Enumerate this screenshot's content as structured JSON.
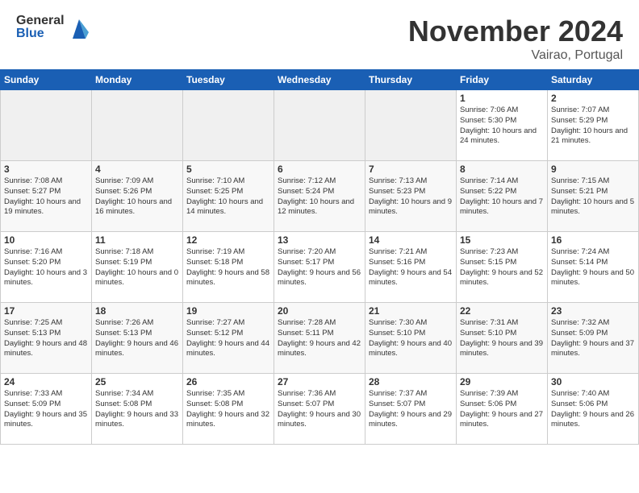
{
  "header": {
    "logo_general": "General",
    "logo_blue": "Blue",
    "month_title": "November 2024",
    "location": "Vairao, Portugal"
  },
  "days_of_week": [
    "Sunday",
    "Monday",
    "Tuesday",
    "Wednesday",
    "Thursday",
    "Friday",
    "Saturday"
  ],
  "weeks": [
    [
      {
        "day": "",
        "info": ""
      },
      {
        "day": "",
        "info": ""
      },
      {
        "day": "",
        "info": ""
      },
      {
        "day": "",
        "info": ""
      },
      {
        "day": "",
        "info": ""
      },
      {
        "day": "1",
        "info": "Sunrise: 7:06 AM\nSunset: 5:30 PM\nDaylight: 10 hours\nand 24 minutes."
      },
      {
        "day": "2",
        "info": "Sunrise: 7:07 AM\nSunset: 5:29 PM\nDaylight: 10 hours\nand 21 minutes."
      }
    ],
    [
      {
        "day": "3",
        "info": "Sunrise: 7:08 AM\nSunset: 5:27 PM\nDaylight: 10 hours\nand 19 minutes."
      },
      {
        "day": "4",
        "info": "Sunrise: 7:09 AM\nSunset: 5:26 PM\nDaylight: 10 hours\nand 16 minutes."
      },
      {
        "day": "5",
        "info": "Sunrise: 7:10 AM\nSunset: 5:25 PM\nDaylight: 10 hours\nand 14 minutes."
      },
      {
        "day": "6",
        "info": "Sunrise: 7:12 AM\nSunset: 5:24 PM\nDaylight: 10 hours\nand 12 minutes."
      },
      {
        "day": "7",
        "info": "Sunrise: 7:13 AM\nSunset: 5:23 PM\nDaylight: 10 hours\nand 9 minutes."
      },
      {
        "day": "8",
        "info": "Sunrise: 7:14 AM\nSunset: 5:22 PM\nDaylight: 10 hours\nand 7 minutes."
      },
      {
        "day": "9",
        "info": "Sunrise: 7:15 AM\nSunset: 5:21 PM\nDaylight: 10 hours\nand 5 minutes."
      }
    ],
    [
      {
        "day": "10",
        "info": "Sunrise: 7:16 AM\nSunset: 5:20 PM\nDaylight: 10 hours\nand 3 minutes."
      },
      {
        "day": "11",
        "info": "Sunrise: 7:18 AM\nSunset: 5:19 PM\nDaylight: 10 hours\nand 0 minutes."
      },
      {
        "day": "12",
        "info": "Sunrise: 7:19 AM\nSunset: 5:18 PM\nDaylight: 9 hours\nand 58 minutes."
      },
      {
        "day": "13",
        "info": "Sunrise: 7:20 AM\nSunset: 5:17 PM\nDaylight: 9 hours\nand 56 minutes."
      },
      {
        "day": "14",
        "info": "Sunrise: 7:21 AM\nSunset: 5:16 PM\nDaylight: 9 hours\nand 54 minutes."
      },
      {
        "day": "15",
        "info": "Sunrise: 7:23 AM\nSunset: 5:15 PM\nDaylight: 9 hours\nand 52 minutes."
      },
      {
        "day": "16",
        "info": "Sunrise: 7:24 AM\nSunset: 5:14 PM\nDaylight: 9 hours\nand 50 minutes."
      }
    ],
    [
      {
        "day": "17",
        "info": "Sunrise: 7:25 AM\nSunset: 5:13 PM\nDaylight: 9 hours\nand 48 minutes."
      },
      {
        "day": "18",
        "info": "Sunrise: 7:26 AM\nSunset: 5:13 PM\nDaylight: 9 hours\nand 46 minutes."
      },
      {
        "day": "19",
        "info": "Sunrise: 7:27 AM\nSunset: 5:12 PM\nDaylight: 9 hours\nand 44 minutes."
      },
      {
        "day": "20",
        "info": "Sunrise: 7:28 AM\nSunset: 5:11 PM\nDaylight: 9 hours\nand 42 minutes."
      },
      {
        "day": "21",
        "info": "Sunrise: 7:30 AM\nSunset: 5:10 PM\nDaylight: 9 hours\nand 40 minutes."
      },
      {
        "day": "22",
        "info": "Sunrise: 7:31 AM\nSunset: 5:10 PM\nDaylight: 9 hours\nand 39 minutes."
      },
      {
        "day": "23",
        "info": "Sunrise: 7:32 AM\nSunset: 5:09 PM\nDaylight: 9 hours\nand 37 minutes."
      }
    ],
    [
      {
        "day": "24",
        "info": "Sunrise: 7:33 AM\nSunset: 5:09 PM\nDaylight: 9 hours\nand 35 minutes."
      },
      {
        "day": "25",
        "info": "Sunrise: 7:34 AM\nSunset: 5:08 PM\nDaylight: 9 hours\nand 33 minutes."
      },
      {
        "day": "26",
        "info": "Sunrise: 7:35 AM\nSunset: 5:08 PM\nDaylight: 9 hours\nand 32 minutes."
      },
      {
        "day": "27",
        "info": "Sunrise: 7:36 AM\nSunset: 5:07 PM\nDaylight: 9 hours\nand 30 minutes."
      },
      {
        "day": "28",
        "info": "Sunrise: 7:37 AM\nSunset: 5:07 PM\nDaylight: 9 hours\nand 29 minutes."
      },
      {
        "day": "29",
        "info": "Sunrise: 7:39 AM\nSunset: 5:06 PM\nDaylight: 9 hours\nand 27 minutes."
      },
      {
        "day": "30",
        "info": "Sunrise: 7:40 AM\nSunset: 5:06 PM\nDaylight: 9 hours\nand 26 minutes."
      }
    ]
  ]
}
